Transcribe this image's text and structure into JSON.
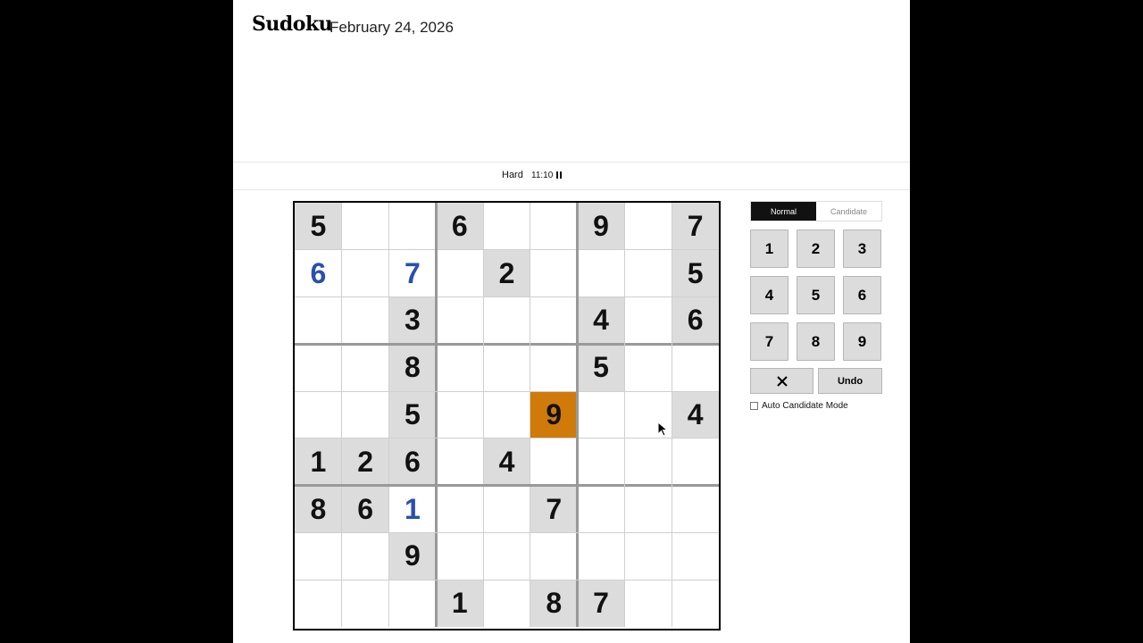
{
  "header": {
    "title": "Sudoku",
    "date": "February 24, 2026"
  },
  "status": {
    "difficulty": "Hard",
    "timer": "11:10"
  },
  "board": {
    "cells": [
      [
        "5",
        "",
        "",
        "6",
        "",
        "",
        "9",
        "",
        "7"
      ],
      [
        "6",
        "",
        "7",
        "",
        "2",
        "",
        "",
        "",
        "5"
      ],
      [
        "",
        "",
        "3",
        "",
        "",
        "",
        "4",
        "",
        "6"
      ],
      [
        "",
        "",
        "8",
        "",
        "",
        "",
        "5",
        "",
        ""
      ],
      [
        "",
        "",
        "5",
        "",
        "",
        "9",
        "",
        "",
        "4"
      ],
      [
        "1",
        "2",
        "6",
        "",
        "4",
        "",
        "",
        "",
        ""
      ],
      [
        "8",
        "6",
        "1",
        "",
        "",
        "7",
        "",
        "",
        ""
      ],
      [
        "",
        "",
        "9",
        "",
        "",
        "",
        "",
        "",
        ""
      ],
      [
        "",
        "",
        "",
        "1",
        "",
        "8",
        "7",
        "",
        ""
      ]
    ],
    "types": [
      [
        "g",
        "",
        "",
        "g",
        "",
        "",
        "g",
        "",
        "g"
      ],
      [
        "u",
        "",
        "u",
        "",
        "g",
        "",
        "",
        "",
        "g"
      ],
      [
        "",
        "",
        "g",
        "",
        "",
        "",
        "g",
        "",
        "g"
      ],
      [
        "",
        "",
        "g",
        "",
        "",
        "",
        "g",
        "",
        ""
      ],
      [
        "",
        "",
        "g",
        "",
        "",
        "s",
        "",
        "",
        "g"
      ],
      [
        "g",
        "g",
        "g",
        "",
        "g",
        "",
        "",
        "",
        ""
      ],
      [
        "g",
        "g",
        "u",
        "",
        "",
        "g",
        "",
        "",
        ""
      ],
      [
        "",
        "",
        "g",
        "",
        "",
        "",
        "",
        "",
        ""
      ],
      [
        "",
        "",
        "",
        "g",
        "",
        "g",
        "g",
        "",
        ""
      ]
    ],
    "colors": {
      "given_bg": "#dcdcdc",
      "user_digit": "#2a4fae",
      "selected_bg": "#d07a0a"
    }
  },
  "controls": {
    "mode_normal": "Normal",
    "mode_candidate": "Candidate",
    "digits": [
      "1",
      "2",
      "3",
      "4",
      "5",
      "6",
      "7",
      "8",
      "9"
    ],
    "erase_icon": "x-icon",
    "undo_label": "Undo",
    "auto_candidate_label": "Auto Candidate Mode"
  }
}
